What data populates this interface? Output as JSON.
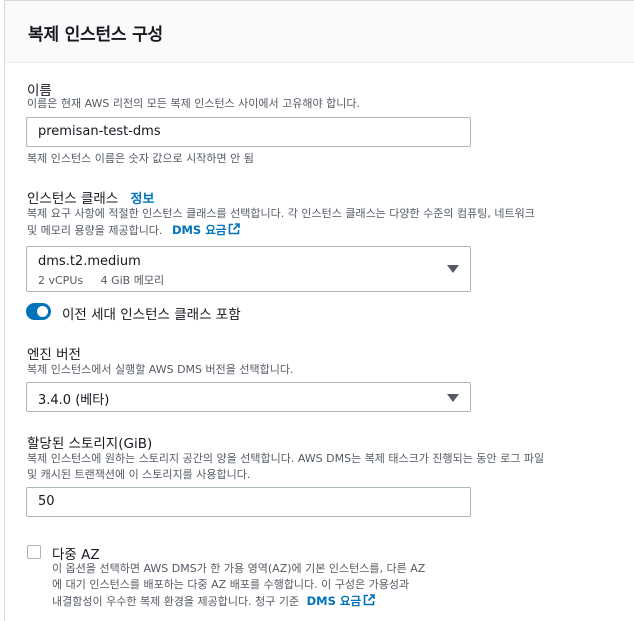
{
  "panel": {
    "title": "복제 인스턴스 구성"
  },
  "name_field": {
    "label": "이름",
    "description": "이름은 현재 AWS 리전의 모든 복제 인스턴스 사이에서 고유해야 합니다.",
    "value": "premisan-test-dms",
    "hint": "복제 인스턴스 이름은 숫자 값으로 시작하면 안 됨"
  },
  "instance_class": {
    "label": "인스턴스 클래스",
    "info_link": "정보",
    "description_line1": "복제 요구 사항에 적절한 인스턴스 클래스를 선택합니다. 각 인스턴스 클래스는 다양한 수준의 컴퓨팅, 네트워크",
    "description_line2": "및 메모리 용량을 제공합니다.",
    "pricing_link": "DMS 요금",
    "selected": "dms.t2.medium",
    "vcpus": "2 vCPUs",
    "memory": "4 GiB 메모리"
  },
  "previous_gen_toggle": {
    "label": "이전 세대 인스턴스 클래스 포함",
    "enabled": true
  },
  "engine_version": {
    "label": "엔진 버전",
    "description": "복제 인스턴스에서 실행할 AWS DMS 버전을 선택합니다.",
    "selected": "3.4.0 (베타)"
  },
  "storage": {
    "label": "할당된 스토리지(GiB)",
    "description_line1": "복제 인스턴스에 원하는 스토리지 공간의 양을 선택합니다. AWS DMS는 복제 태스크가 진행되는 동안 로그 파일",
    "description_line2": "및 캐시된 트랜잭션에 이 스토리지를 사용합니다.",
    "value": "50"
  },
  "multi_az": {
    "label": "다중 AZ",
    "checked": false,
    "description_line1": "이 옵션을 선택하면 AWS DMS가 한 가용 영역(AZ)에 기본 인스턴스를, 다른 AZ",
    "description_line2": "에 대기 인스턴스를 배포하는 다중 AZ 배포를 수행합니다. 이 구성은 가용성과",
    "description_line3": "내결함성이 우수한 복제 환경을 제공합니다. 청구 기준",
    "pricing_link": "DMS 요금"
  },
  "colors": {
    "accent": "#0073bb",
    "text": "#16191f",
    "muted": "#545b64",
    "border": "#aab7b8"
  }
}
